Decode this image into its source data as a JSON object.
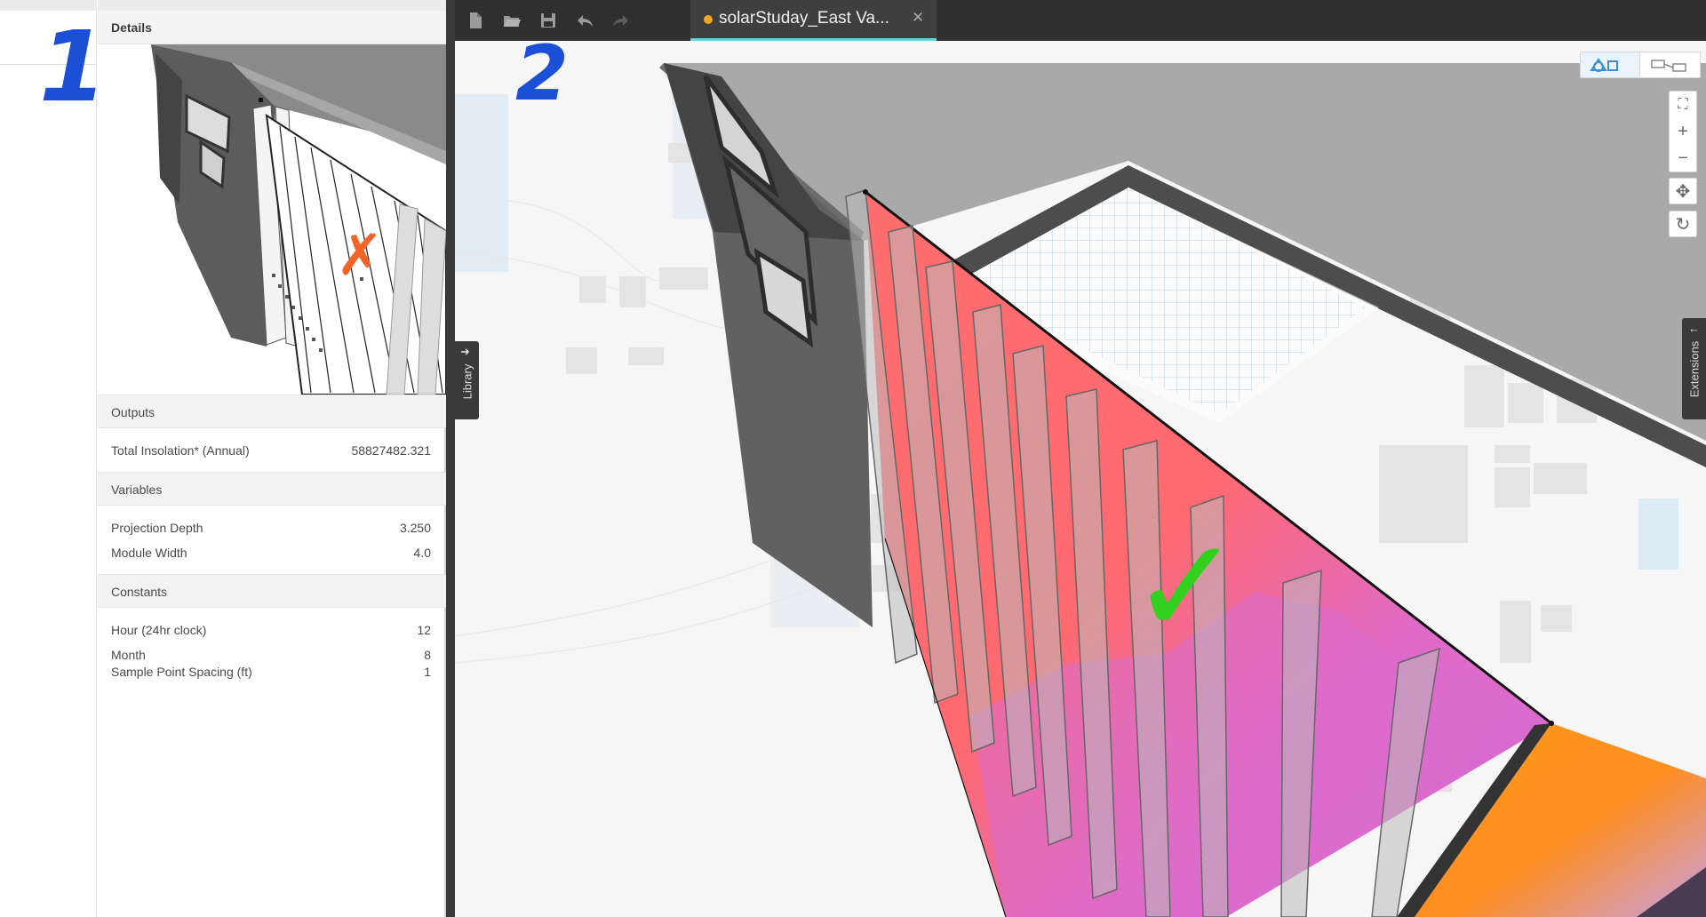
{
  "details": {
    "header": "Details",
    "outputs": {
      "title": "Outputs",
      "rows": [
        {
          "label": "Total Insolation* (Annual)",
          "value": "58827482.321"
        }
      ]
    },
    "variables": {
      "title": "Variables",
      "rows": [
        {
          "label": "Projection Depth",
          "value": "3.250"
        },
        {
          "label": "Module Width",
          "value": "4.0"
        }
      ]
    },
    "constants": {
      "title": "Constants",
      "rows": [
        {
          "label": "Hour (24hr clock)",
          "value": "12"
        },
        {
          "label": "Month",
          "value": "8"
        },
        {
          "label": "Sample Point Spacing (ft)",
          "value": "1"
        }
      ]
    }
  },
  "annotations": {
    "left_number": "1",
    "right_number": "2",
    "left_mark": "✗",
    "right_mark": "✓",
    "left_mark_color": "#f0642a",
    "right_mark_color": "#33d11f",
    "number_color": "#1b4fd6"
  },
  "toolbar": {
    "icons": [
      "new-file-icon",
      "open-folder-icon",
      "save-icon",
      "undo-icon",
      "redo-icon"
    ],
    "tab_title": "solarStuday_East Va...",
    "tab_close": "✕",
    "tab_dirty_color": "#f5a623"
  },
  "side_tabs": {
    "library": "Library",
    "extensions": "Extensions"
  },
  "zoom": {
    "fit": "⛶",
    "in": "+",
    "out": "−",
    "pan": "✥",
    "orbit": "↻"
  },
  "colors": {
    "accent_tab_underline": "#6fd0dc",
    "heat_hot": "#ff6b6b",
    "heat_cool": "#d86bd0",
    "heat_orange": "#ff9a1a"
  }
}
